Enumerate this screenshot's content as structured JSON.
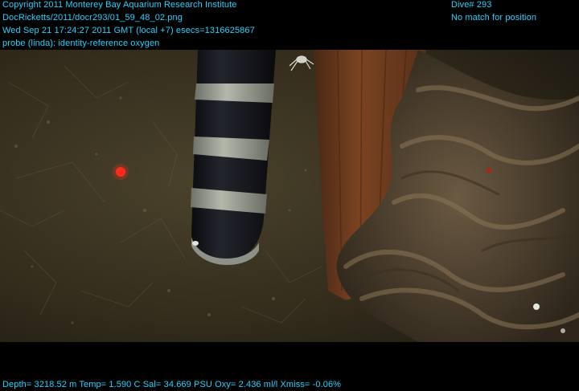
{
  "overlay": {
    "top_left": [
      "Copyright 2011 Monterey Bay Aquarium Research Institute",
      "DocRicketts/2011/docr293/01_59_48_02.png",
      "Wed Sep 21 17:24:27 2011 GMT (local +7)  esecs=1316625867",
      "probe (linda): identity-reference oxygen"
    ],
    "top_right": [
      "Dive# 293",
      "No match for position"
    ],
    "bottom": "Depth= 3218.52 m  Temp= 1.590 C  Sal= 34.669 PSU  Oxy= 2.436 ml/l  Xmiss= -0.06%"
  },
  "colors": {
    "overlay_text": "#22d3ff",
    "sediment": "#3a3320",
    "wood": "#6b3a1e",
    "rope": "#5a4a36",
    "probe_body": "#15161c",
    "probe_band": "#9a9f94",
    "laser": "#ff2a1a"
  },
  "scene": {
    "objects": [
      "sediment-seafloor",
      "probe-cylinder",
      "wooden-plank",
      "coiled-rope",
      "laser-dot",
      "small-crab"
    ]
  }
}
